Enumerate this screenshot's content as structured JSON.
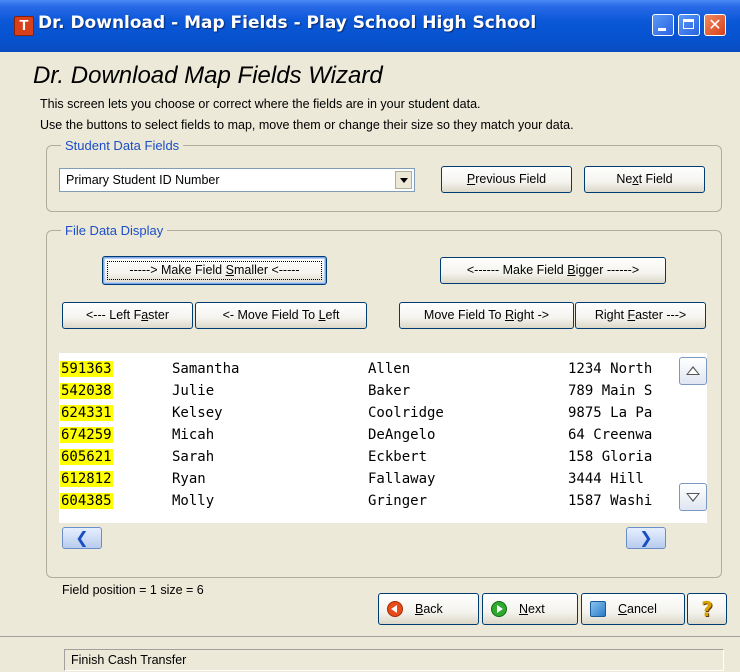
{
  "window": {
    "title": "Dr. Download - Map Fields - Play School High School",
    "icon_letter": "T",
    "close_glyph": "✕"
  },
  "wizard": {
    "heading": "Dr. Download Map Fields Wizard",
    "description_line1": "This screen lets you choose or correct where the fields are in your student data.",
    "description_line2": "Use the buttons to select fields to map, move them or change their size so they match your data."
  },
  "student_fields": {
    "legend": "Student Data Fields",
    "selected_field": "Primary Student ID Number",
    "previous_button": {
      "pre": "",
      "key": "P",
      "post": "revious Field"
    },
    "next_button": {
      "pre": "Ne",
      "key": "x",
      "post": "t Field"
    }
  },
  "file_display": {
    "legend": "File Data Display",
    "smaller_button": {
      "pre": "-----> Make Field ",
      "key": "S",
      "post": "maller <-----"
    },
    "bigger_button": {
      "pre": "<------ Make Field ",
      "key": "B",
      "post": "igger ------>"
    },
    "left_faster_button": {
      "pre": "<--- Left F",
      "key": "a",
      "post": "ster"
    },
    "move_left_button": {
      "pre": "<- Move Field To ",
      "key": "L",
      "post": "eft"
    },
    "move_right_button": {
      "pre": "Move Field To ",
      "key": "R",
      "post": "ight ->"
    },
    "right_faster_button": {
      "pre": "Right ",
      "key": "F",
      "post": "aster --->"
    },
    "rows": [
      {
        "id": "591363",
        "first": "Samantha",
        "last": "Allen",
        "address": "1234 North"
      },
      {
        "id": "542038",
        "first": "Julie",
        "last": "Baker",
        "address": "789 Main S"
      },
      {
        "id": "624331",
        "first": "Kelsey",
        "last": "Coolridge",
        "address": "9875 La Pa"
      },
      {
        "id": "674259",
        "first": "Micah",
        "last": "DeAngelo",
        "address": "64 Creenwa"
      },
      {
        "id": "605621",
        "first": "Sarah",
        "last": "Eckbert",
        "address": "158 Gloria"
      },
      {
        "id": "612812",
        "first": "Ryan",
        "last": "Fallaway",
        "address": "3444 Hill"
      },
      {
        "id": "604385",
        "first": "Molly",
        "last": "Gringer",
        "address": "1587 Washi"
      }
    ],
    "scroll_left_glyph": "❮",
    "scroll_right_glyph": "❯"
  },
  "footer": {
    "field_position": "Field position = 1  size = 6",
    "back_button": {
      "pre": "",
      "key": "B",
      "post": "ack"
    },
    "next_button": {
      "pre": "",
      "key": "N",
      "post": "ext"
    },
    "cancel_button": {
      "pre": "",
      "key": "C",
      "post": "ancel"
    },
    "help_glyph": "?"
  },
  "status": {
    "text": "Finish Cash Transfer"
  },
  "colors": {
    "title_bar": "#0652cf",
    "legend_text": "#1c4ec8",
    "highlight": "#ffff00",
    "face": "#ece9d8"
  }
}
